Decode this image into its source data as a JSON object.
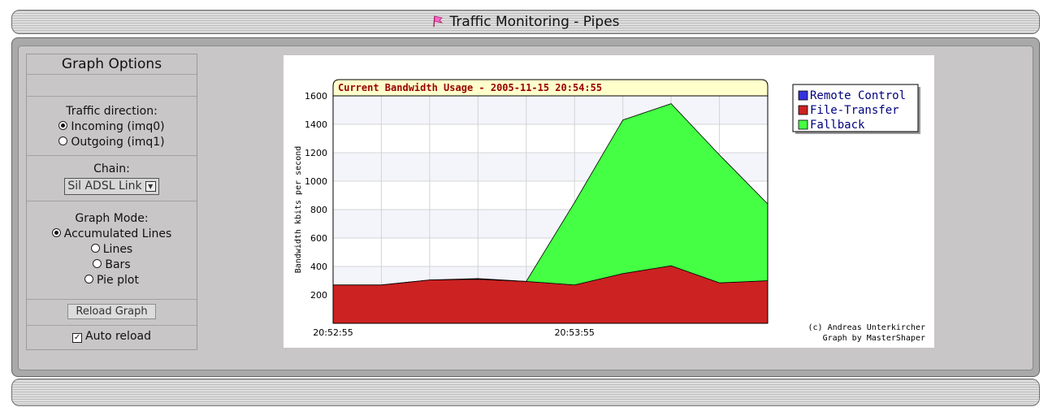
{
  "header": {
    "title": "Traffic Monitoring - Pipes",
    "icon": "flag-icon"
  },
  "sidebar": {
    "title": "Graph Options",
    "direction": {
      "label": "Traffic direction:",
      "options": [
        "Incoming (imq0)",
        "Outgoing (imq1)"
      ],
      "selected": "Incoming (imq0)"
    },
    "chain": {
      "label": "Chain:",
      "value": "Sil ADSL Link"
    },
    "mode": {
      "label": "Graph Mode:",
      "options": [
        "Accumulated Lines",
        "Lines",
        "Bars",
        "Pie plot"
      ],
      "selected": "Accumulated Lines"
    },
    "reload_label": "Reload Graph",
    "auto_reload_label": "Auto reload",
    "auto_reload_checked": true
  },
  "chart_data": {
    "type": "area",
    "title": "Current Bandwidth Usage - 2005-11-15 20:54:55",
    "ylabel": "Bandwidth kbits per second",
    "xlabel": "",
    "ylim": [
      0,
      1600
    ],
    "yticks": [
      200,
      400,
      600,
      800,
      1000,
      1200,
      1400,
      1600
    ],
    "x": [
      0,
      1,
      2,
      3,
      4,
      5,
      6,
      7,
      8,
      9
    ],
    "xtick_labels": [
      {
        "index": 0,
        "label": "20:52:55"
      },
      {
        "index": 5,
        "label": "20:53:55"
      }
    ],
    "stacked": true,
    "grid": true,
    "legend_position": "top-right",
    "series": [
      {
        "name": "Remote Control",
        "color": "#3333dd",
        "values": [
          0,
          0,
          0,
          0,
          0,
          0,
          0,
          0,
          0,
          0
        ]
      },
      {
        "name": "File-Transfer",
        "color": "#cc2222",
        "values": [
          270,
          270,
          305,
          310,
          295,
          270,
          350,
          405,
          285,
          300
        ]
      },
      {
        "name": "Fallback",
        "color": "#44ff44",
        "values": [
          0,
          0,
          0,
          5,
          0,
          580,
          1080,
          1140,
          900,
          540
        ]
      }
    ],
    "credits": [
      "(c) Andreas Unterkircher",
      "Graph by MasterShaper"
    ]
  }
}
